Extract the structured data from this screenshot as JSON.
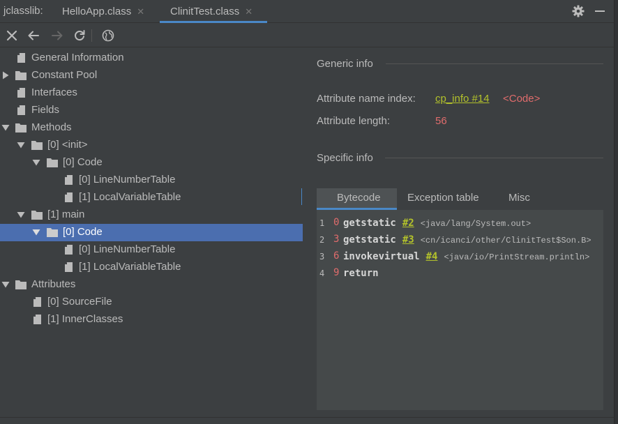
{
  "window": {
    "tool_title": "jclasslib:",
    "tabs": [
      {
        "label": "HelloApp.class",
        "active": false
      },
      {
        "label": "ClinitTest.class",
        "active": true
      }
    ]
  },
  "toolbar": {
    "icons": [
      "close-icon",
      "back-arrow-icon",
      "forward-arrow-icon",
      "refresh-icon",
      "globe-icon"
    ]
  },
  "tree": {
    "general_information": "General Information",
    "constant_pool": "Constant Pool",
    "interfaces": "Interfaces",
    "fields": "Fields",
    "methods": "Methods",
    "init_method": "[0] <init>",
    "init_code": "[0] Code",
    "init_line_number_table": "[0] LineNumberTable",
    "init_local_variable_table": "[1] LocalVariableTable",
    "main_method": "[1] main",
    "main_code": "[0] Code",
    "main_line_number_table": "[0] LineNumberTable",
    "main_local_variable_table": "[1] LocalVariableTable",
    "attributes": "Attributes",
    "source_file": "[0] SourceFile",
    "inner_classes": "[1] InnerClasses",
    "selected": "main_code"
  },
  "detail": {
    "generic_info_title": "Generic info",
    "attribute_name_index_label": "Attribute name index:",
    "attribute_name_index_link": "cp_info #14",
    "attribute_name_index_value": "<Code>",
    "attribute_length_label": "Attribute length:",
    "attribute_length_value": "56",
    "specific_info_title": "Specific info",
    "tabs": [
      {
        "label": "Bytecode",
        "active": true
      },
      {
        "label": "Exception table",
        "active": false
      },
      {
        "label": "Misc",
        "active": false
      }
    ],
    "bytecode": [
      {
        "line": "1",
        "offset": "0",
        "opcode": "getstatic",
        "ref": "#2",
        "comment": "<java/lang/System.out>"
      },
      {
        "line": "2",
        "offset": "3",
        "opcode": "getstatic",
        "ref": "#3",
        "comment": "<cn/icanci/other/ClinitTest$Son.B>"
      },
      {
        "line": "3",
        "offset": "6",
        "opcode": "invokevirtual",
        "ref": "#4",
        "comment": "<java/io/PrintStream.println>"
      },
      {
        "line": "4",
        "offset": "9",
        "opcode": "return",
        "ref": "",
        "comment": ""
      }
    ]
  },
  "colors": {
    "background": "#3c3f41",
    "selection": "#4b6eaf",
    "accent": "#4a88c7",
    "link": "#b3c22b",
    "number": "#e06c6c"
  }
}
